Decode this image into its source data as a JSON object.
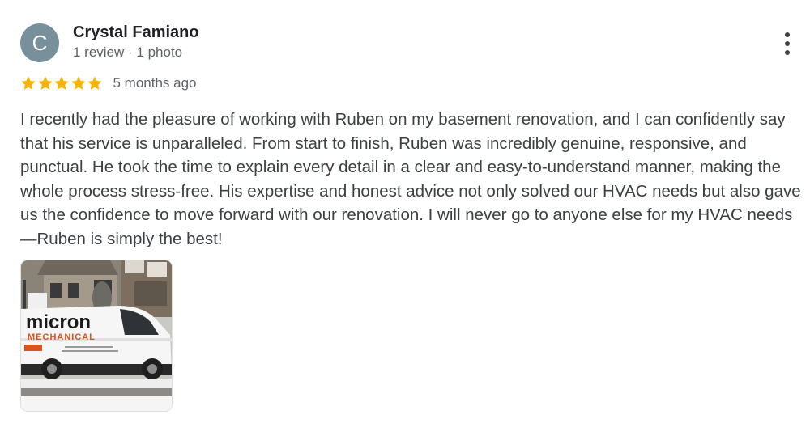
{
  "reviewer": {
    "initial": "C",
    "name": "Crystal Famiano",
    "meta": "1 review · 1 photo",
    "avatar_color": "#78909c"
  },
  "review": {
    "rating": 5,
    "max_rating": 5,
    "star_color": "#f4b400",
    "time_ago": "5 months ago",
    "text": "I recently had the pleasure of working with Ruben on my basement renovation, and I can confidently say that his service is unparalleled. From start to finish, Ruben was incredibly genuine, responsive, and punctual. He took the time to explain every detail in a clear and easy-to-understand manner, making the whole process stress-free. His expertise and honest advice not only solved our HVAC needs but also gave us the confidence to move forward with our renovation. I will never go to anyone else for my HVAC needs—Ruben is simply the best!"
  },
  "actions": {
    "more_icon": "more-vert-icon"
  },
  "photo": {
    "brand_line1": "micron",
    "brand_line2": "MECHANICAL",
    "brand_color": "#1a1a1a",
    "accent_color": "#d9541e"
  }
}
